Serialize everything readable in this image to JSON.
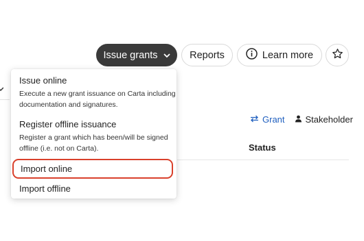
{
  "toolbar": {
    "issue_grants_label": "Issue grants",
    "reports_label": "Reports",
    "learn_more_label": "Learn more"
  },
  "view_toggle": {
    "grant_label": "Grant",
    "stakeholder_label": "Stakeholder"
  },
  "table": {
    "status_header": "Status"
  },
  "menu": {
    "items": [
      {
        "title": "Issue online",
        "description": "Execute a new grant issuance on Carta including documentation and signatures."
      },
      {
        "title": "Register offline issuance",
        "description": "Register a grant which has been/will be signed offline (i.e. not on Carta)."
      },
      {
        "title": "Import online"
      },
      {
        "title": "Import offline"
      }
    ]
  },
  "colors": {
    "primary_button": "#3a3a3a",
    "link_blue": "#1f5fbf",
    "highlight_red": "#d9402b"
  }
}
